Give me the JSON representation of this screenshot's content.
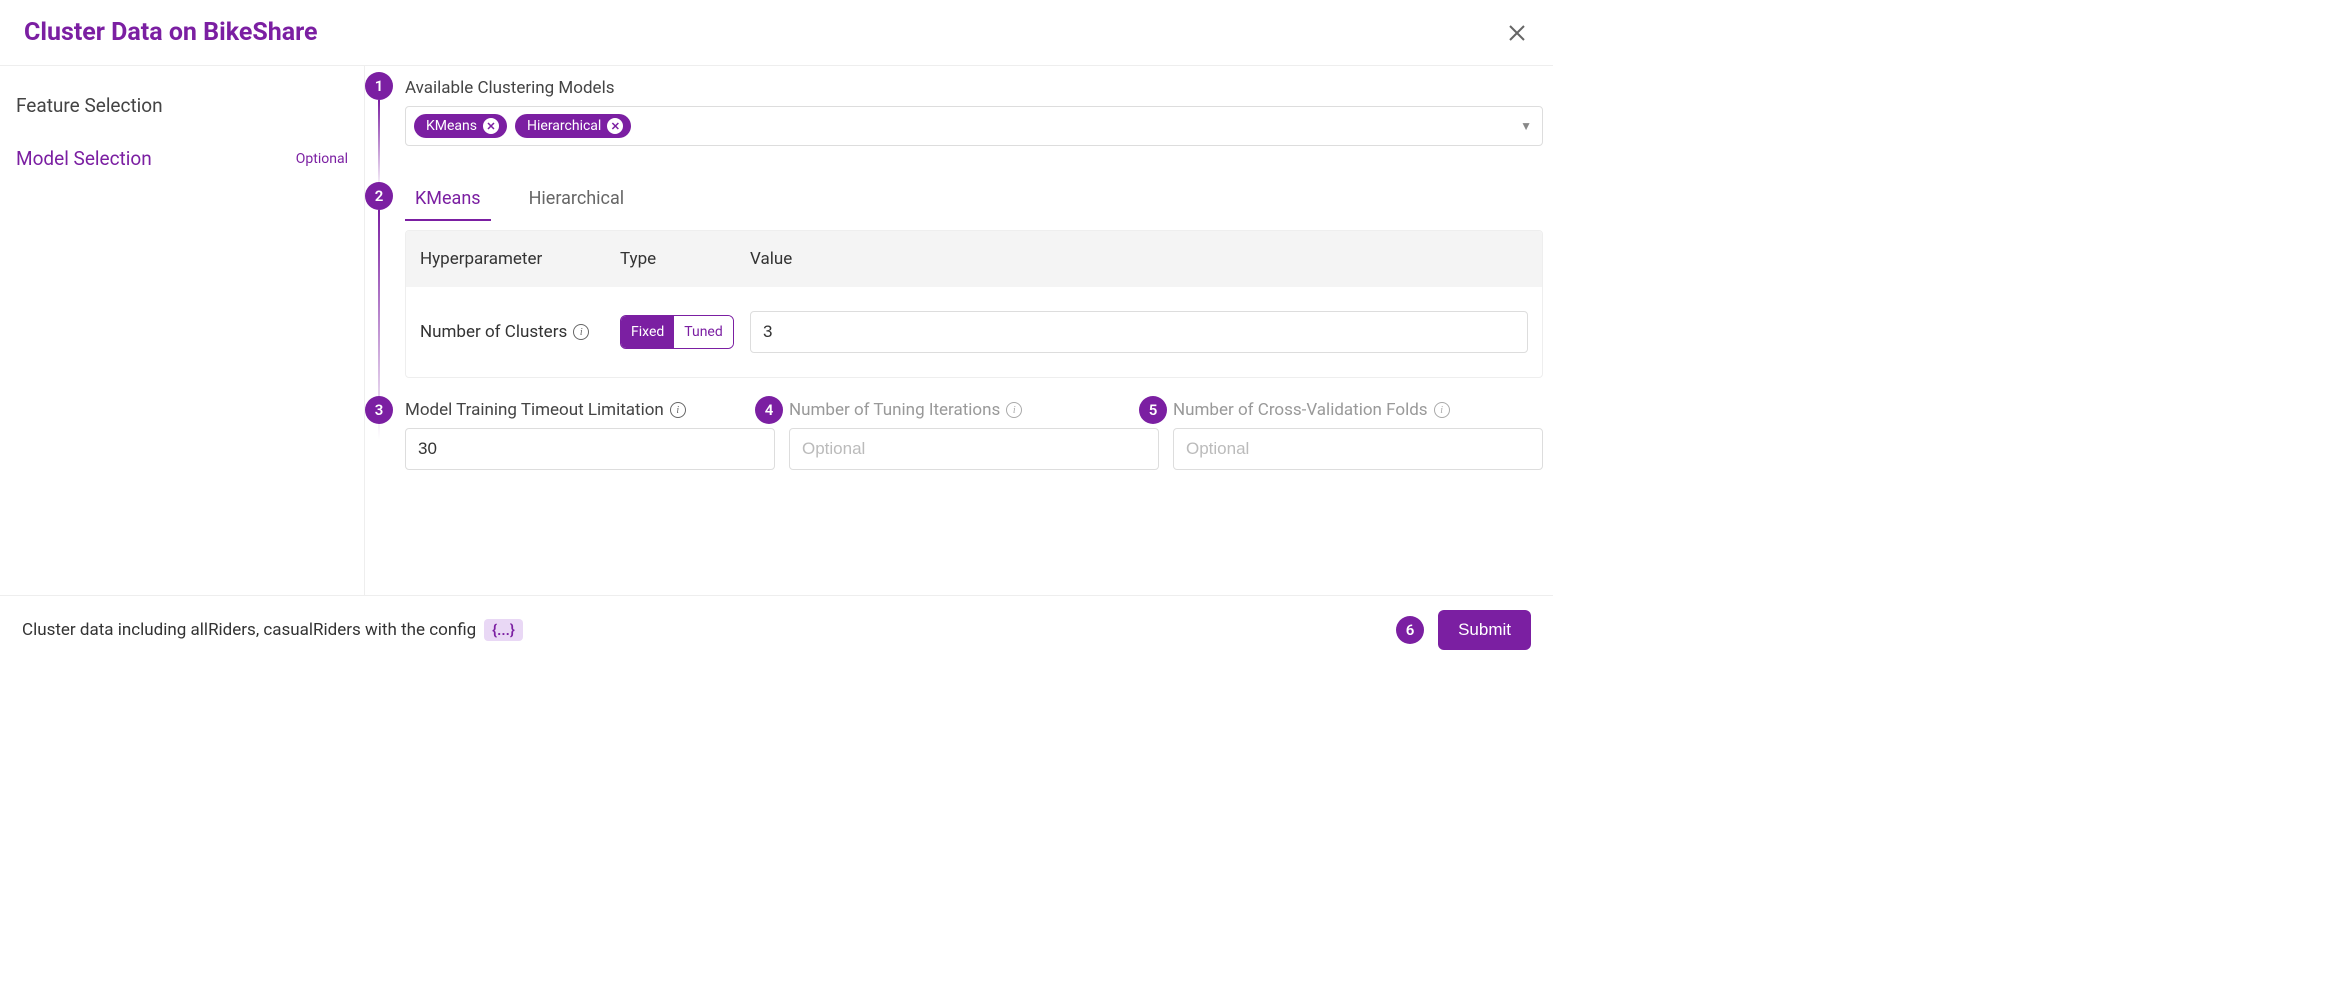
{
  "title": "Cluster Data on BikeShare",
  "sidebar": {
    "items": [
      {
        "label": "Feature Selection",
        "optional": ""
      },
      {
        "label": "Model Selection",
        "optional": "Optional"
      }
    ]
  },
  "steps": {
    "s1": "1",
    "s2": "2",
    "s3": "3",
    "s4": "4",
    "s5": "5",
    "s6": "6"
  },
  "models": {
    "label": "Available Clustering Models",
    "chips": [
      {
        "name": "KMeans"
      },
      {
        "name": "Hierarchical"
      }
    ]
  },
  "tabs": [
    {
      "label": "KMeans"
    },
    {
      "label": "Hierarchical"
    }
  ],
  "table": {
    "headers": {
      "hp": "Hyperparameter",
      "type": "Type",
      "value": "Value"
    },
    "rows": [
      {
        "name": "Number of Clusters",
        "toggle": {
          "fixed": "Fixed",
          "tuned": "Tuned"
        },
        "value": "3"
      }
    ]
  },
  "params": {
    "timeout": {
      "label": "Model Training Timeout Limitation",
      "value": "30"
    },
    "iterations": {
      "label": "Number of Tuning Iterations",
      "placeholder": "Optional"
    },
    "folds": {
      "label": "Number of Cross-Validation Folds",
      "placeholder": "Optional"
    }
  },
  "footer": {
    "text": "Cluster data including allRiders, casualRiders with the config",
    "config": "{...}",
    "submit": "Submit"
  }
}
